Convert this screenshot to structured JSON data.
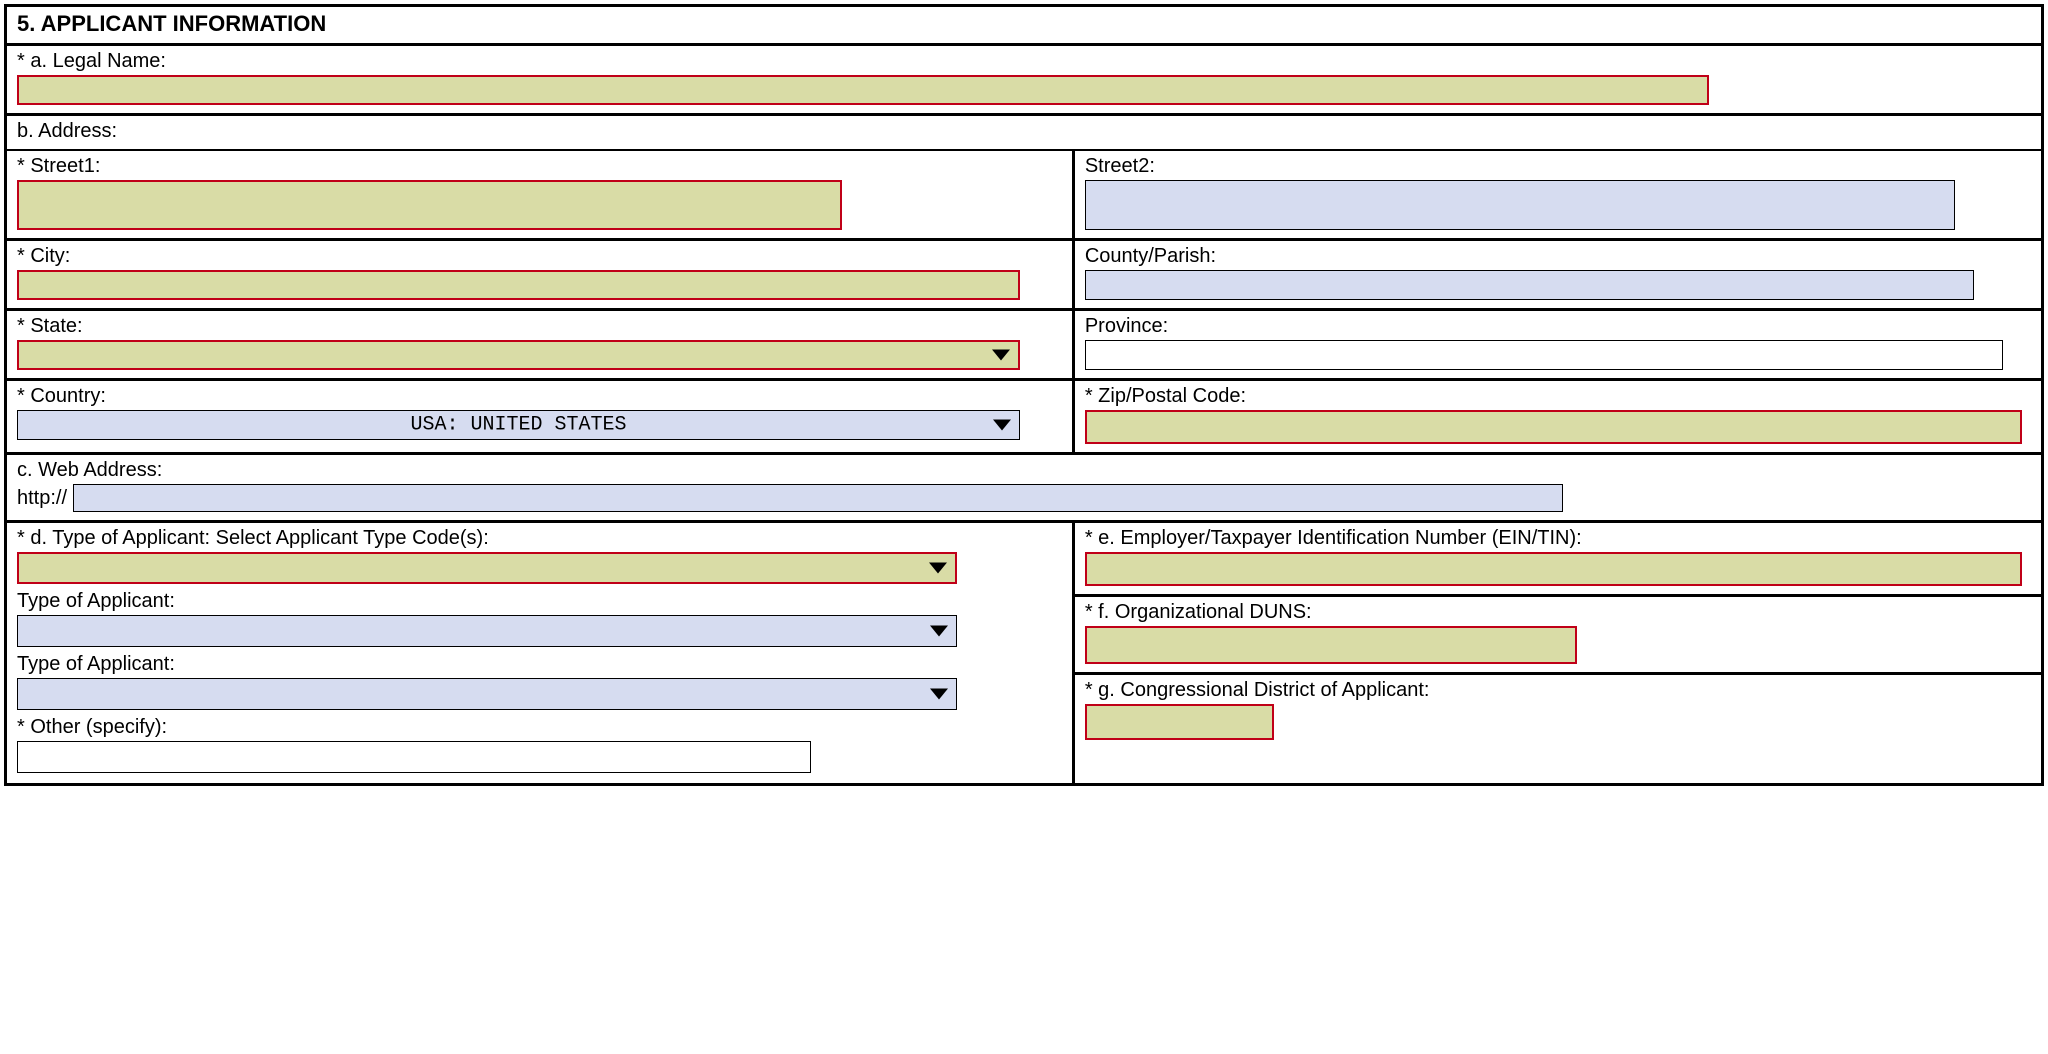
{
  "section": {
    "header": "5. APPLICANT INFORMATION"
  },
  "labels": {
    "legal_name": "* a. Legal Name:",
    "address": "b. Address:",
    "street1": "* Street1:",
    "street2": "Street2:",
    "city": "* City:",
    "county": "County/Parish:",
    "state": "* State:",
    "province": "Province:",
    "country": "* Country:",
    "zip": "* Zip/Postal Code:",
    "web_address": "c. Web Address:",
    "http": "http://",
    "applicant_type_d": "* d. Type of Applicant:  Select Applicant Type Code(s):",
    "applicant_type": "Type of Applicant:",
    "other_specify": "* Other (specify):",
    "ein": "* e. Employer/Taxpayer Identification Number (EIN/TIN):",
    "duns": "* f. Organizational DUNS:",
    "cong_dist": "* g. Congressional District of  Applicant:"
  },
  "values": {
    "country": "USA: UNITED STATES"
  }
}
